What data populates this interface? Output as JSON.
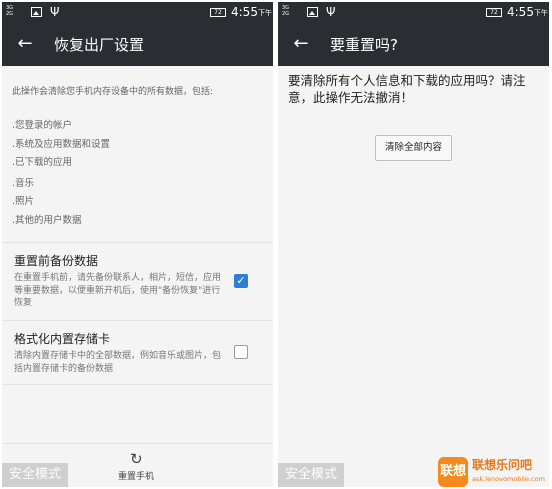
{
  "status_bar": {
    "signal_top": "3G",
    "signal_bottom": "2G",
    "battery": "72",
    "time": "4:55",
    "ampm": "下午"
  },
  "left_screen": {
    "title": "恢复出厂设置",
    "description": "此操作会清除您手机内存设备中的所有数据，包括:",
    "bullets": [
      ".您登录的帐户",
      ".系统及应用数据和设置",
      ".已下载的应用",
      ".音乐",
      ".照片",
      ".其他的用户数据"
    ],
    "options": [
      {
        "title": "重置前备份数据",
        "subtitle": "在重置手机前，请先备份联系人，相片，短信，应用等重要数据，以便重新开机后，使用\"备份恢复\"进行恢复",
        "checked": true
      },
      {
        "title": "格式化内置存储卡",
        "subtitle": "清除内置存储卡中的全部数据，例如音乐或图片，包括内置存储卡的备份数据",
        "checked": false
      }
    ],
    "reset_button_label": "重置手机",
    "safe_mode": "安全模式"
  },
  "right_screen": {
    "title": "要重置吗?",
    "message": "要清除所有个人信息和下载的应用吗？请注意，此操作无法撤消！",
    "clear_all_button": "清除全部内容",
    "safe_mode": "安全模式"
  },
  "watermark": {
    "logo_text": "联想",
    "title": "联想乐问吧",
    "url": "ask.lenovomobile.com"
  },
  "colors": {
    "app_bar": "#2a2d32",
    "checkbox_checked": "#2f7fd8",
    "watermark_orange": "#f28a1c"
  },
  "icons": {
    "back": "arrow-left",
    "refresh": "refresh",
    "usb": "usb",
    "image": "image"
  }
}
